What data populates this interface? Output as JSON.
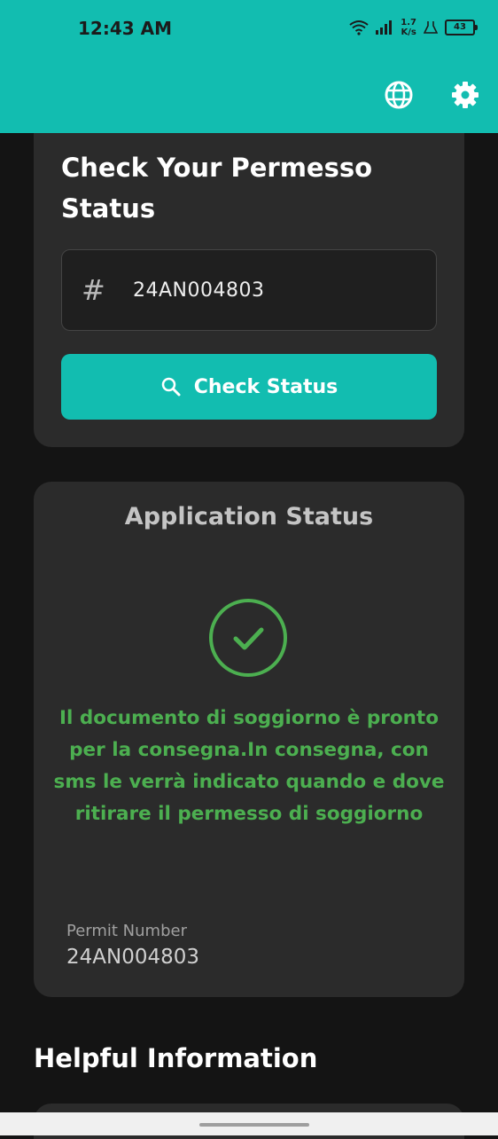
{
  "status_bar": {
    "time": "12:43 AM",
    "net_speed_value": "1.7",
    "net_speed_unit": "K/s",
    "battery": "43"
  },
  "appbar": {
    "icons": [
      "globe-icon",
      "gear-icon"
    ],
    "color": "#12bdb0"
  },
  "check_card": {
    "title": "Check Your Permesso Status",
    "input_prefix": "#",
    "input_value": "24AN004803",
    "button_label": "Check Status"
  },
  "status_card": {
    "title": "Application Status",
    "message": "Il documento di soggiorno è pronto per la consegna.In consegna, con sms le verrà indicato quando e dove ritirare il permesso di soggiorno",
    "permit_label": "Permit Number",
    "permit_value": "24AN004803",
    "success_color": "#4caf50"
  },
  "helpful": {
    "title": "Helpful Information"
  }
}
